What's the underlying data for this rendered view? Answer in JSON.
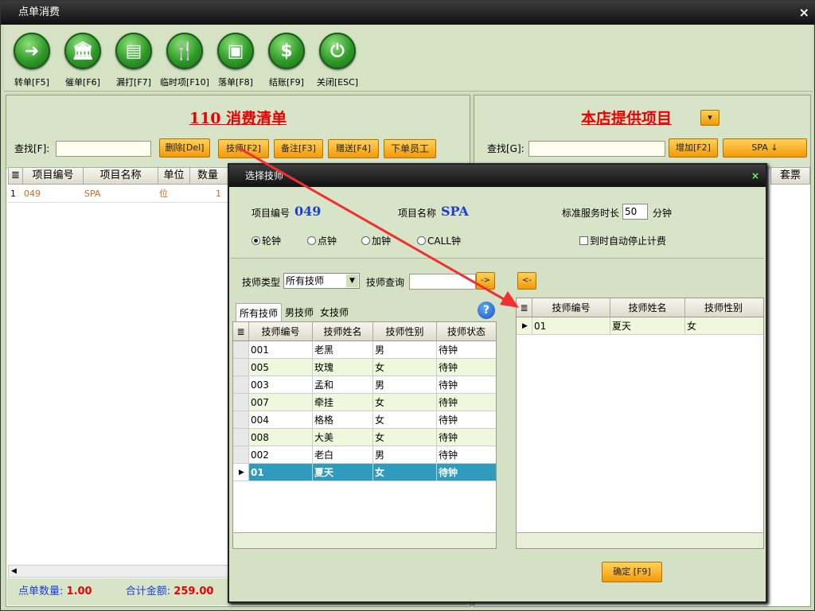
{
  "window": {
    "title": "点单消费",
    "close": "×"
  },
  "toolbar": [
    {
      "label": "转单[F5]",
      "icon": "➜",
      "name": "transfer-button"
    },
    {
      "label": "催单[F6]",
      "icon": "🏛",
      "name": "urge-button"
    },
    {
      "label": "漏打[F7]",
      "icon": "▤",
      "name": "reprint-button"
    },
    {
      "label": "临时项[F10]",
      "icon": "🍴",
      "name": "temp-item-button"
    },
    {
      "label": "落单[F8]",
      "icon": "▣",
      "name": "place-order-button"
    },
    {
      "label": "结账[F9]",
      "icon": "$",
      "name": "checkout-button"
    },
    {
      "label": "关闭[ESC]",
      "icon": "⏻",
      "name": "close-button"
    }
  ],
  "left": {
    "title": "110 消费清单",
    "search_label": "查找[F]:",
    "buttons": {
      "delete": "删除[Del]",
      "tech": "技师[F2]",
      "note": "备注[F3]",
      "gift": "赠送[F4]",
      "staff": "下单员工"
    },
    "columns": [
      "项目编号",
      "项目名称",
      "单位",
      "数量"
    ],
    "rows": [
      {
        "idx": "1",
        "code": "049",
        "name": "SPA",
        "unit": "位",
        "qty": "1"
      }
    ],
    "footer": {
      "count_label": "点单数量:",
      "count": "1.00",
      "total_label": "合计金额:",
      "total": "259.00"
    }
  },
  "right": {
    "title": "本店提供项目",
    "search_label": "查找[G]:",
    "add": "增加[F2]",
    "category": "SPA ↓",
    "col_tail": "套票"
  },
  "dialog": {
    "title": "选择技师",
    "close": "×",
    "item_code_label": "项目编号",
    "item_code": "049",
    "item_name_label": "项目名称",
    "item_name": "SPA",
    "duration_label": "标准服务时长",
    "duration": "50",
    "duration_unit": "分钟",
    "modes": [
      "轮钟",
      "点钟",
      "加钟",
      "CALL钟"
    ],
    "auto_stop": "到时自动停止计费",
    "type_label": "技师类型",
    "type_value": "所有技师",
    "query_label": "技师查询",
    "add_arrow": "->",
    "remove_arrow": "<-",
    "tabs": [
      "所有技师",
      "男技师",
      "女技师"
    ],
    "help": "?",
    "columns": [
      "技师编号",
      "技师姓名",
      "技师性别",
      "技师状态"
    ],
    "rows": [
      {
        "code": "001",
        "name": "老黑",
        "gender": "男",
        "status": "待钟"
      },
      {
        "code": "005",
        "name": "玫瑰",
        "gender": "女",
        "status": "待钟"
      },
      {
        "code": "003",
        "name": "孟和",
        "gender": "男",
        "status": "待钟"
      },
      {
        "code": "007",
        "name": "牵挂",
        "gender": "女",
        "status": "待钟"
      },
      {
        "code": "004",
        "name": "格格",
        "gender": "女",
        "status": "待钟"
      },
      {
        "code": "008",
        "name": "大美",
        "gender": "女",
        "status": "待钟"
      },
      {
        "code": "002",
        "name": "老白",
        "gender": "男",
        "status": "待钟"
      },
      {
        "code": "01",
        "name": "夏天",
        "gender": "女",
        "status": "待钟"
      }
    ],
    "selected_columns": [
      "技师编号",
      "技师姓名",
      "技师性别"
    ],
    "selected_rows": [
      {
        "code": "01",
        "name": "夏天",
        "gender": "女"
      }
    ],
    "confirm": "确定 [F9]"
  },
  "colors": {
    "accent": "#f19a08",
    "title_red": "#e00000",
    "blue": "#1a3fd6",
    "selected_row": "#2f9bbd"
  }
}
